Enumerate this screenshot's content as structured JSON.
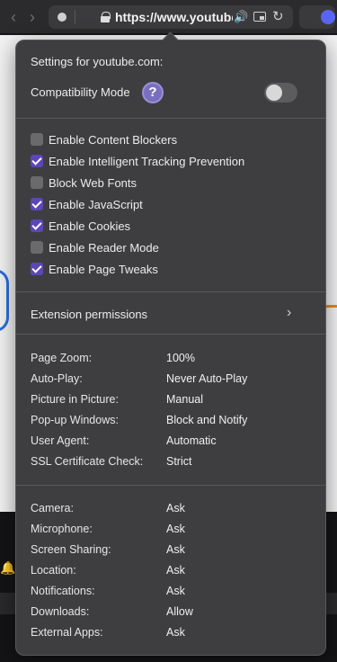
{
  "browser": {
    "url": "https://www.youtube.com"
  },
  "popover": {
    "title": "Settings for youtube.com:",
    "compatibility_label": "Compatibility Mode",
    "help_glyph": "?",
    "compatibility_enabled": false,
    "checkboxes": [
      {
        "label": "Enable Content Blockers",
        "checked": false
      },
      {
        "label": "Enable Intelligent Tracking Prevention",
        "checked": true
      },
      {
        "label": "Block Web Fonts",
        "checked": false
      },
      {
        "label": "Enable JavaScript",
        "checked": true
      },
      {
        "label": "Enable Cookies",
        "checked": true
      },
      {
        "label": "Enable Reader Mode",
        "checked": false
      },
      {
        "label": "Enable Page Tweaks",
        "checked": true
      }
    ],
    "extension_permissions_label": "Extension permissions",
    "page_settings": [
      {
        "label": "Page Zoom:",
        "value": "100%"
      },
      {
        "label": "Auto-Play:",
        "value": "Never Auto-Play"
      },
      {
        "label": "Picture in Picture:",
        "value": "Manual"
      },
      {
        "label": "Pop-up Windows:",
        "value": "Block and Notify"
      },
      {
        "label": "User Agent:",
        "value": "Automatic"
      },
      {
        "label": "SSL Certificate Check:",
        "value": "Strict"
      }
    ],
    "permissions": [
      {
        "label": "Camera:",
        "value": "Ask"
      },
      {
        "label": "Microphone:",
        "value": "Ask"
      },
      {
        "label": "Screen Sharing:",
        "value": "Ask"
      },
      {
        "label": "Location:",
        "value": "Ask"
      },
      {
        "label": "Notifications:",
        "value": "Ask"
      },
      {
        "label": "Downloads:",
        "value": "Allow"
      },
      {
        "label": "External Apps:",
        "value": "Ask"
      }
    ]
  },
  "colors": {
    "accent": "#5b47b8",
    "popover_bg": "#3e3e40"
  }
}
